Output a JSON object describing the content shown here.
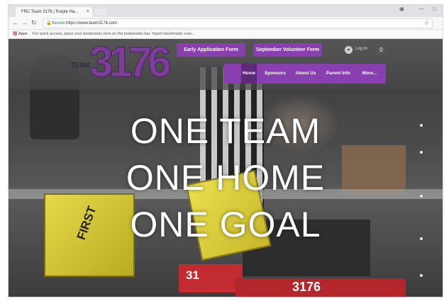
{
  "browser": {
    "tab_title": "FRC Team 3176 | Purple Ha...",
    "tab_close": "×",
    "address_secure": "Secure",
    "address_url": "https://www.team3176.com",
    "bookmarks_apps": "Apps",
    "bookmarks_hint": "For quick access, place your bookmarks here on the bookmarks bar. Import bookmarks now..."
  },
  "icons": {
    "back": "back-arrow-icon",
    "forward": "forward-arrow-icon",
    "reload": "reload-icon",
    "star": "star-icon",
    "apps": "apps-grid-icon",
    "user": "user-icon",
    "minimize": "minimize-icon"
  },
  "site": {
    "logo": {
      "prefix": "TEAM",
      "number": "3176"
    },
    "top_buttons": [
      {
        "label": "Early Application Form"
      },
      {
        "label": "September Volunteer Form"
      }
    ],
    "login_label": "Log In",
    "cart_count": "0",
    "nav": [
      {
        "label": "Home",
        "active": true
      },
      {
        "label": "Sponsors",
        "active": false
      },
      {
        "label": "About Us",
        "active": false
      },
      {
        "label": "Parent Info",
        "active": false
      },
      {
        "label": "More...",
        "active": false
      }
    ],
    "hero": [
      "ONE TEAM",
      "ONE HOME",
      "ONE GOAL"
    ],
    "photo_text": {
      "first_logo": "FIRST",
      "bumper_number": "3176",
      "bumper_number_left": "31"
    }
  },
  "colors": {
    "brand_purple": "#8a3fb0",
    "nav_active": "#5d2a7a",
    "logo_purple": "#7c3f98"
  }
}
